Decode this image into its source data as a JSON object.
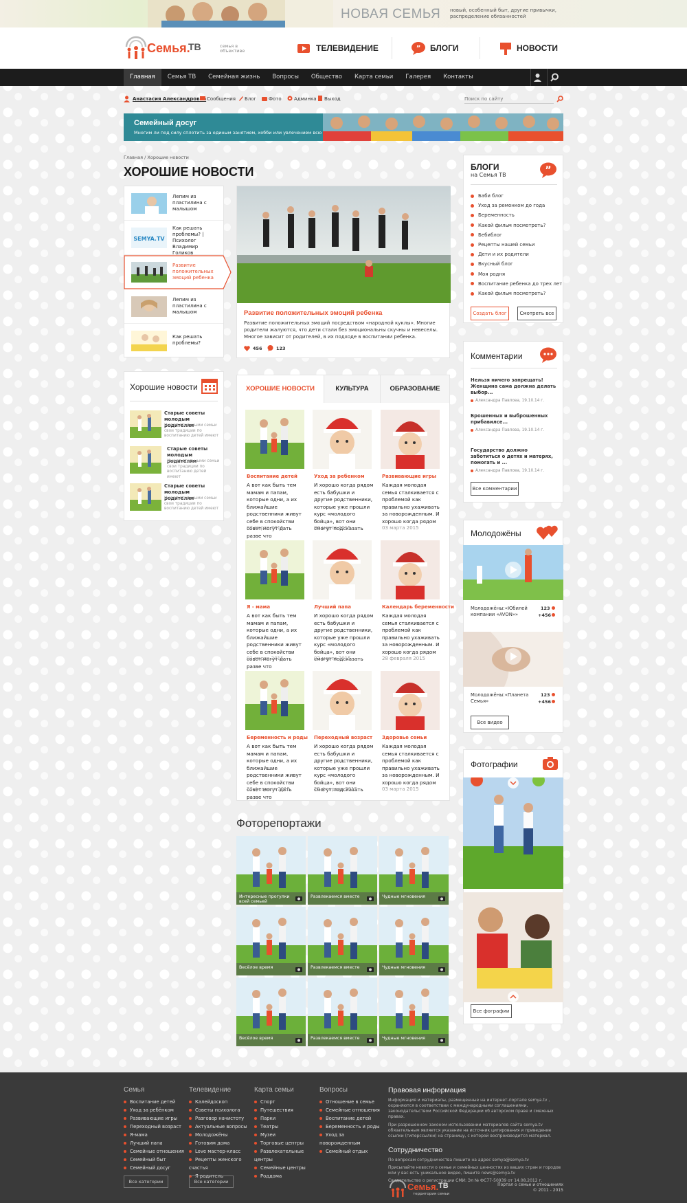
{
  "banner": {
    "title": "НОВАЯ СЕМЬЯ",
    "text": "новый, особенный быт, другие привычки, распределение обязанностей"
  },
  "logo": {
    "name": "Семья.",
    "tv": "ТВ",
    "tagline": "семья в объективе"
  },
  "header_nav": [
    {
      "label": "ТЕЛЕВИДЕНИЕ"
    },
    {
      "label": "БЛОГИ"
    },
    {
      "label": "НОВОСТИ"
    }
  ],
  "nav": [
    "Главная",
    "Семья ТВ",
    "Семейная жизнь",
    "Вопросы",
    "Общество",
    "Карта семьи",
    "Галерея",
    "Контакты"
  ],
  "userbar": {
    "name": "Анастасия Александровна",
    "links": [
      "Сообщения",
      "Блог",
      "Фото",
      "Админка",
      "Выход"
    ],
    "search_placeholder": "Поиск по сайту"
  },
  "promo": {
    "title": "Семейный досуг",
    "text": "Многим ли под силу сплотить за единым занятием, хобби или увлечением всю"
  },
  "breadcrumb": [
    "Главная",
    "Хорошие новости"
  ],
  "page_title": "ХОРОШИЕ НОВОСТИ",
  "slider_items": [
    "Лепим из пластилина с малышом",
    "Как решать проблемы? | Психолог Владимир Голиков",
    "Развитие положительных эмоций ребенка",
    "Лепим из пластилина с малышом",
    "Как решать проблемы?"
  ],
  "feature": {
    "title": "Развитие положительных эмоций ребенка",
    "text": "Развитие положительных эмоций посредством «народной куклы». Многие родители жалуются, что дети стали без эмоциональны скучны и невеселы. Многое зависит от родителей, в их подходе в воспитании ребенка.",
    "likes": "456",
    "comments": "123"
  },
  "good_news": {
    "title": "Хорошие новости",
    "items": [
      {
        "title": "Старые советы молодым родителям",
        "text": "Имеют стильными семьи свои традиции по воспитанию детей имеют"
      },
      {
        "title": "Старые советы молодым родителям",
        "text": "Имеют стильными семьи свои традиции по воспитанию детей имеют"
      },
      {
        "title": "Старые советы молодым родителям",
        "text": "Имеют стильными семьи свои традиции по воспитанию детей имеют"
      }
    ]
  },
  "tabs": [
    "ХОРОШИЕ НОВОСТИ",
    "КУЛЬТУРА",
    "ОБРАЗОВАНИЕ"
  ],
  "news": [
    {
      "cat": "Воспитание детей",
      "text": "А вот как быть тем мамам и папам, которые одни, а их ближайшие родственники живут себе в спокойстви совет могут дать разве что",
      "date": "03 марта 2015"
    },
    {
      "cat": "Уход за ребенком",
      "text": "И хорошо когда рядом есть бабушки и другие родственники, которые уже прошли курс «молодого бойца», вот они смогут подсказать",
      "date": "03 марта 2015"
    },
    {
      "cat": "Развивающие игры",
      "text": "Каждая молодая семья сталкивается с проблемой как правильно ухаживать за новорожденным. И хорошо когда рядом",
      "date": "03 марта 2015"
    },
    {
      "cat": "Я - мама",
      "text": "А вот как быть тем мамам и папам, которые одни, а их ближайшие родственники живут себе в спокойстви совет могут дать разве что",
      "date": "01 марта 2015"
    },
    {
      "cat": "Лучший папа",
      "text": "И хорошо когда рядом есть бабушки и другие родственники, которые уже прошли курс «молодого бойца», вот они смогут подсказать",
      "date": "02 марта 2015"
    },
    {
      "cat": "Календарь беременности",
      "text": "Каждая молодая семья сталкивается с проблемой как правильно ухаживать за новорожденным. И хорошо когда рядом",
      "date": "28 февраля 2015"
    },
    {
      "cat": "Беременность и роды",
      "text": "А вот как быть тем мамам и папам, которые одни, а их ближайшие родственники живут себе в спокойстви совет могут дать разве что",
      "date": "23 февраля 2015"
    },
    {
      "cat": "Переходный возраст",
      "text": "И хорошо когда рядом есть бабушки и другие родственники, которые уже прошли курс «молодого бойца», вот они смогут подсказать",
      "date": "25 февраля 2015"
    },
    {
      "cat": "Здоровье семьи",
      "text": "Каждая молодая семья сталкивается с проблемой как правильно ухаживать за новорожденным. И хорошо когда рядом",
      "date": "03 марта 2015"
    }
  ],
  "photo_reports": {
    "title": "Фоторепортажи",
    "items": [
      "Интересные прогулки всей семьей",
      "Развлекаемся вместе",
      "Чудные мгновения",
      "Весёлое время",
      "Развлекаемся вместе",
      "Чудные мгновения",
      "Весёлое время",
      "Развлекаемся вместе",
      "Чудные мгновения"
    ]
  },
  "blogs": {
    "title": "БЛОГИ",
    "subtitle": "на Семья ТВ",
    "items": [
      "Баби блог",
      "Уход за ремонком до года",
      "Беременность",
      "Какой фильм посмотреть?",
      "Бебиблог",
      "Рецепты нашей семьи",
      "Дети и их родители",
      "Вкусный блог",
      "Моя родня",
      "Воспитание ребенка до трех лет",
      "Какой фильм посмотреть?"
    ],
    "create": "Создать блог",
    "all": "Смотреть все"
  },
  "comments": {
    "title": "Комментарии",
    "items": [
      {
        "title": "Нельзя ничего запрещать! Женщина сама должна делать выбор...",
        "meta": "Александра Павлова, 19.10.14 г."
      },
      {
        "title": "Брошенных и выброшенных прибавилсе...",
        "meta": "Александра Павлова, 19.10.14 г."
      },
      {
        "title": "Государство должно заботиться о детях и матерях, помогать и ...",
        "meta": "Александра Павлова, 19.10.14 г."
      }
    ],
    "all": "Все комментарии"
  },
  "newlyweds": {
    "title": "Молодожёны",
    "items": [
      {
        "title": "Молодожёны:«Юбилей компании «AVON»»",
        "views": "123",
        "likes": "+456"
      },
      {
        "title": "Молодожёны:«Планета Семья»",
        "views": "123",
        "likes": "+456"
      }
    ],
    "all": "Все видео"
  },
  "photos": {
    "title": "Фотографии",
    "all": "Все фографии"
  },
  "footer": {
    "cols": [
      {
        "title": "Семья",
        "items": [
          "Воспитание детей",
          "Уход за ребёнком",
          "Развивающие игры",
          "Переходный возраст",
          "Я-мама",
          "Лучший папа",
          "Семейные отношения",
          "Семейный быт",
          "Семейный досуг"
        ],
        "btn": "Все категории"
      },
      {
        "title": "Телевидение",
        "items": [
          "Калейдоскоп",
          "Советы психолога",
          "Разговор начистоту",
          "Актуальные вопросы",
          "Молодожёны",
          "Готовим дома",
          "Love мастер-класс",
          "Рецепты женского счастья",
          "Я родитель"
        ],
        "btn": "Все категории"
      },
      {
        "title": "Карта семьи",
        "items": [
          "Спорт",
          "Путешествия",
          "Парки",
          "Театры",
          "Музеи",
          "Торговые центры",
          "Развлекательные центры",
          "Семейные центры",
          "Роддома"
        ]
      },
      {
        "title": "Вопросы",
        "items": [
          "Отношение в семье",
          "Семейные отношения",
          "Воспитание детей",
          "Беременность и роды",
          "Уход за новорожденным",
          "Семейный отдых"
        ]
      }
    ],
    "legal_title": "Правовая информация",
    "legal_text1": "Информация и материалы, размещенные на интернет-портале semya.tv , охраняются в соответствии с международными соглашениями, законодательством Российской Федерации об авторском праве и смежных правах.",
    "legal_text2": "При разрешенном законом использовании материалов сайта semya.tv обязательным является указание на источник цитирования и приведение ссылки (гиперссылки) на страницу, с которой воспроизводится материал.",
    "coop_title": "Сотрудничество",
    "coop_text1": "По вопросам сотрудничества пишите на адрес semya@semya.tv",
    "coop_text2": "Присылайте новости о семье и семейных ценностях из ваших стран и городов или у вас есть уникальное видео, пишите news@semya.tv",
    "coop_text3": "Свидетельство о регистрации СМИ: Эл № ФС77-50939 от 14.08.2012 г.",
    "logo_tag": "территория семьи",
    "portal": "Портал о семье и отношениях",
    "copyright": "© 2011 - 2015"
  }
}
